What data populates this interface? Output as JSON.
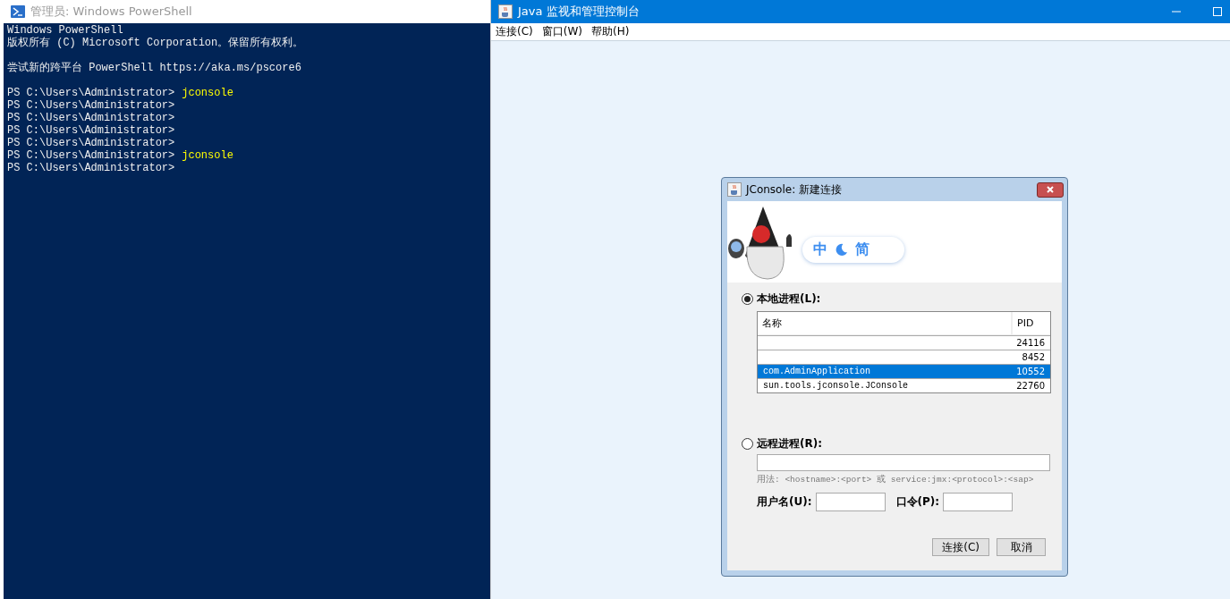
{
  "powershell": {
    "title": "管理员: Windows PowerShell",
    "blocks": [
      [
        {
          "text": "Windows PowerShell"
        },
        {
          "text": "版权所有 (C) Microsoft Corporation。保留所有权利。"
        }
      ],
      [
        {
          "text": "尝试新的跨平台 PowerShell https://aka.ms/pscore6"
        }
      ],
      [
        {
          "text": "PS C:\\Users\\Administrator>",
          "command": "jconsole"
        },
        {
          "text": "PS C:\\Users\\Administrator>"
        },
        {
          "text": "PS C:\\Users\\Administrator>"
        },
        {
          "text": "PS C:\\Users\\Administrator>"
        },
        {
          "text": "PS C:\\Users\\Administrator>"
        },
        {
          "text": "PS C:\\Users\\Administrator>",
          "command": "jconsole"
        },
        {
          "text": "PS C:\\Users\\Administrator>"
        }
      ]
    ]
  },
  "jconsole": {
    "title": "Java 监视和管理控制台",
    "menu": [
      "连接(C)",
      "窗口(W)",
      "帮助(H)"
    ],
    "dialog": {
      "title": "JConsole: 新建连接",
      "ime_badge": {
        "left": "中",
        "right": "简"
      },
      "local": {
        "label": "本地进程(L):",
        "selected": true,
        "columns": [
          "名称",
          "PID"
        ],
        "rows": [
          {
            "pid": "24116",
            "selected": false
          },
          {
            "pid": "8452",
            "selected": false
          },
          {
            "name": "com.AdminApplication",
            "pid": "10552",
            "selected": true
          },
          {
            "name": "sun.tools.jconsole.JConsole",
            "pid": "22760",
            "selected": false
          }
        ]
      },
      "remote": {
        "label": "远程进程(R):",
        "selected": false,
        "usage": "用法: <hostname>:<port> 或 service:jmx:<protocol>:<sap>"
      },
      "username_label": "用户名(U):",
      "password_label": "口令(P):",
      "buttons": [
        "连接(C)",
        "取消"
      ]
    }
  }
}
